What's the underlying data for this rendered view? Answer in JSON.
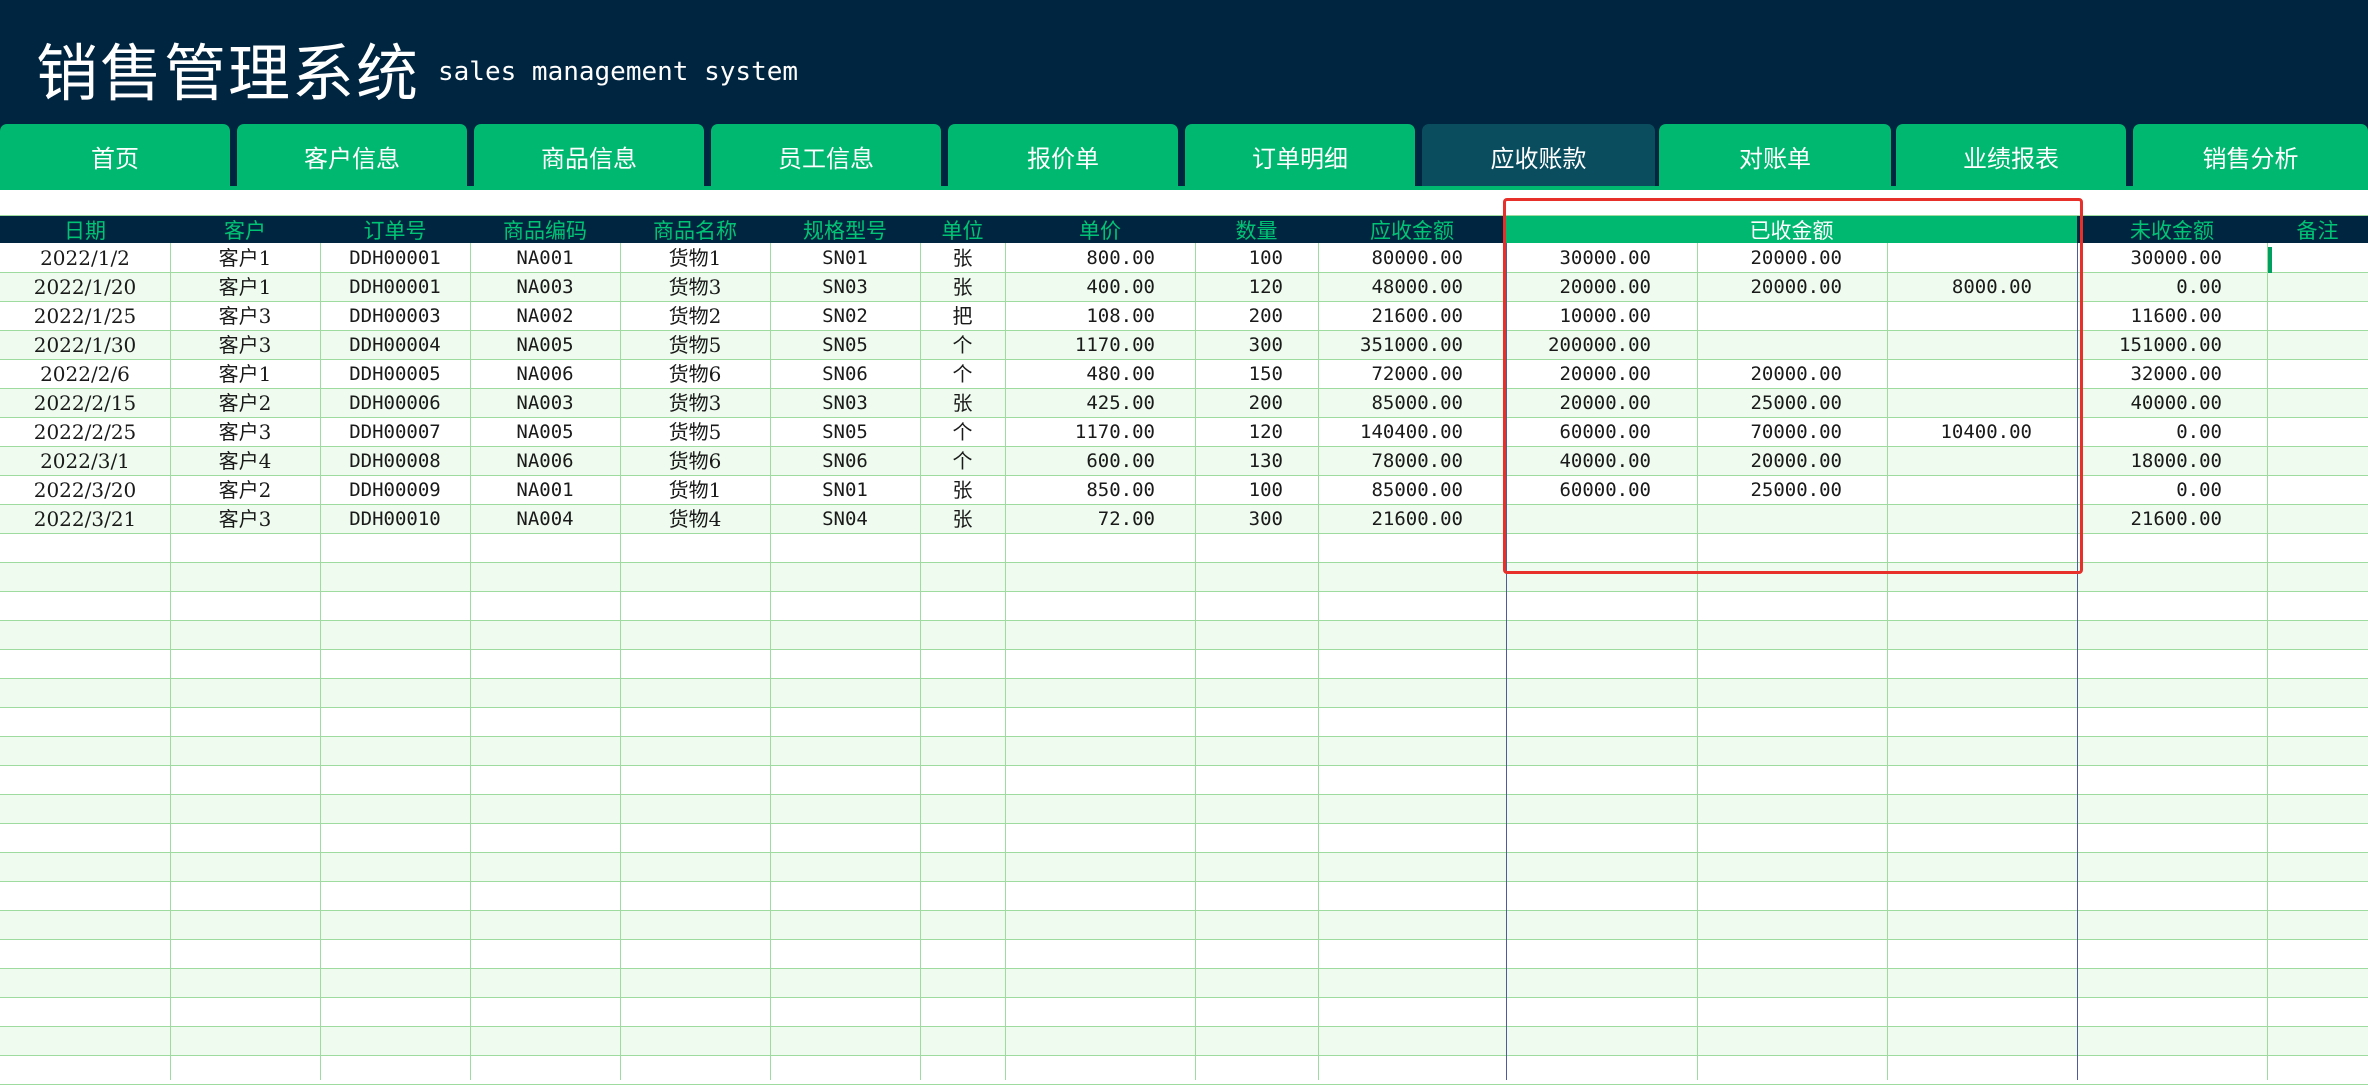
{
  "app": {
    "title": "销售管理系统",
    "subtitle": "sales management system"
  },
  "nav": {
    "active": "应收账款",
    "tabs": [
      {
        "label": "首页"
      },
      {
        "label": "客户信息"
      },
      {
        "label": "商品信息"
      },
      {
        "label": "员工信息"
      },
      {
        "label": "报价单"
      },
      {
        "label": "订单明细"
      },
      {
        "label": "应收账款"
      },
      {
        "label": "对账单"
      },
      {
        "label": "业绩报表"
      },
      {
        "label": "销售分析"
      }
    ]
  },
  "colors": {
    "header_bg": "#002540",
    "tab_green": "#00b870",
    "tab_active": "#0a4d5e",
    "header_text": "#00c474",
    "grid_line": "#9edb9e",
    "row_stripe": "#eefbee",
    "highlight": "#e8302a"
  },
  "table": {
    "headers": {
      "date": "日期",
      "customer": "客户",
      "order_no": "订单号",
      "product_code": "商品编码",
      "product_name": "商品名称",
      "spec": "规格型号",
      "unit": "单位",
      "unit_price": "单价",
      "qty": "数量",
      "receivable": "应收金额",
      "received": "已收金额",
      "unreceived": "未收金额",
      "remark": "备注"
    },
    "rows": [
      {
        "date": "2022/1/2",
        "customer": "客户1",
        "order_no": "DDH00001",
        "product_code": "NA001",
        "product_name": "货物1",
        "spec": "SN01",
        "unit": "张",
        "unit_price": "800.00",
        "qty": "100",
        "receivable": "80000.00",
        "received1": "30000.00",
        "received2": "20000.00",
        "received3": "",
        "unreceived": "30000.00"
      },
      {
        "date": "2022/1/20",
        "customer": "客户1",
        "order_no": "DDH00001",
        "product_code": "NA003",
        "product_name": "货物3",
        "spec": "SN03",
        "unit": "张",
        "unit_price": "400.00",
        "qty": "120",
        "receivable": "48000.00",
        "received1": "20000.00",
        "received2": "20000.00",
        "received3": "8000.00",
        "unreceived": "0.00"
      },
      {
        "date": "2022/1/25",
        "customer": "客户3",
        "order_no": "DDH00003",
        "product_code": "NA002",
        "product_name": "货物2",
        "spec": "SN02",
        "unit": "把",
        "unit_price": "108.00",
        "qty": "200",
        "receivable": "21600.00",
        "received1": "10000.00",
        "received2": "",
        "received3": "",
        "unreceived": "11600.00"
      },
      {
        "date": "2022/1/30",
        "customer": "客户3",
        "order_no": "DDH00004",
        "product_code": "NA005",
        "product_name": "货物5",
        "spec": "SN05",
        "unit": "个",
        "unit_price": "1170.00",
        "qty": "300",
        "receivable": "351000.00",
        "received1": "200000.00",
        "received2": "",
        "received3": "",
        "unreceived": "151000.00"
      },
      {
        "date": "2022/2/6",
        "customer": "客户1",
        "order_no": "DDH00005",
        "product_code": "NA006",
        "product_name": "货物6",
        "spec": "SN06",
        "unit": "个",
        "unit_price": "480.00",
        "qty": "150",
        "receivable": "72000.00",
        "received1": "20000.00",
        "received2": "20000.00",
        "received3": "",
        "unreceived": "32000.00"
      },
      {
        "date": "2022/2/15",
        "customer": "客户2",
        "order_no": "DDH00006",
        "product_code": "NA003",
        "product_name": "货物3",
        "spec": "SN03",
        "unit": "张",
        "unit_price": "425.00",
        "qty": "200",
        "receivable": "85000.00",
        "received1": "20000.00",
        "received2": "25000.00",
        "received3": "",
        "unreceived": "40000.00"
      },
      {
        "date": "2022/2/25",
        "customer": "客户3",
        "order_no": "DDH00007",
        "product_code": "NA005",
        "product_name": "货物5",
        "spec": "SN05",
        "unit": "个",
        "unit_price": "1170.00",
        "qty": "120",
        "receivable": "140400.00",
        "received1": "60000.00",
        "received2": "70000.00",
        "received3": "10400.00",
        "unreceived": "0.00"
      },
      {
        "date": "2022/3/1",
        "customer": "客户4",
        "order_no": "DDH00008",
        "product_code": "NA006",
        "product_name": "货物6",
        "spec": "SN06",
        "unit": "个",
        "unit_price": "600.00",
        "qty": "130",
        "receivable": "78000.00",
        "received1": "40000.00",
        "received2": "20000.00",
        "received3": "",
        "unreceived": "18000.00"
      },
      {
        "date": "2022/3/20",
        "customer": "客户2",
        "order_no": "DDH00009",
        "product_code": "NA001",
        "product_name": "货物1",
        "spec": "SN01",
        "unit": "张",
        "unit_price": "850.00",
        "qty": "100",
        "receivable": "85000.00",
        "received1": "60000.00",
        "received2": "25000.00",
        "received3": "",
        "unreceived": "0.00"
      },
      {
        "date": "2022/3/21",
        "customer": "客户3",
        "order_no": "DDH00010",
        "product_code": "NA004",
        "product_name": "货物4",
        "spec": "SN04",
        "unit": "张",
        "unit_price": "72.00",
        "qty": "300",
        "receivable": "21600.00",
        "received1": "",
        "received2": "",
        "received3": "",
        "unreceived": "21600.00"
      }
    ]
  }
}
